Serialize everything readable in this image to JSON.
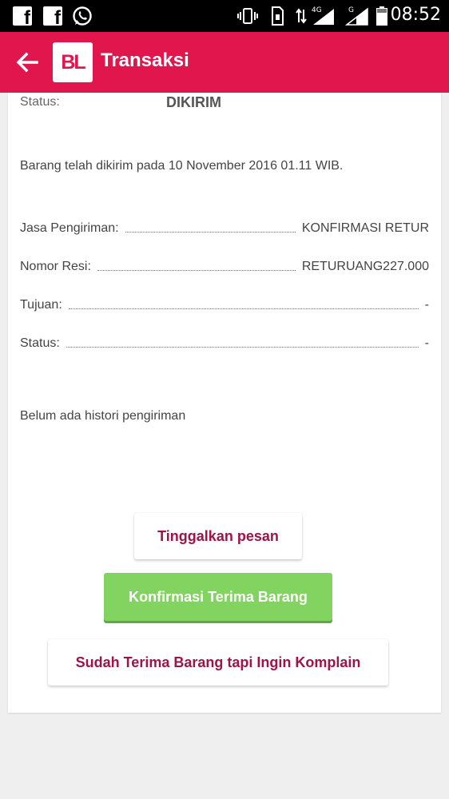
{
  "statusbar": {
    "network_4g": "4G",
    "network_g": "G",
    "time": "08:52"
  },
  "appbar": {
    "logo_text": "BL",
    "title": "Transaksi"
  },
  "order": {
    "status_label": "Status:",
    "status_value": "DIKIRIM",
    "sent_message": "Barang telah dikirim pada 10 November 2016 01.11 WIB."
  },
  "shipping": {
    "rows": [
      {
        "label": "Jasa Pengiriman:",
        "value": "KONFIRMASI RETUR"
      },
      {
        "label": "Nomor Resi:",
        "value": "RETURUANG227.000"
      },
      {
        "label": "Tujuan:",
        "value": "-"
      },
      {
        "label": "Status:",
        "value": "-"
      }
    ],
    "no_history": "Belum ada histori pengiriman"
  },
  "actions": {
    "leave_message": "Tinggalkan pesan",
    "confirm_receipt": "Konfirmasi Terima Barang",
    "complain": "Sudah Terima Barang tapi Ingin Komplain"
  },
  "colors": {
    "brand": "#e0164d",
    "confirm_green": "#82d35f",
    "button_text": "#a0124a"
  }
}
